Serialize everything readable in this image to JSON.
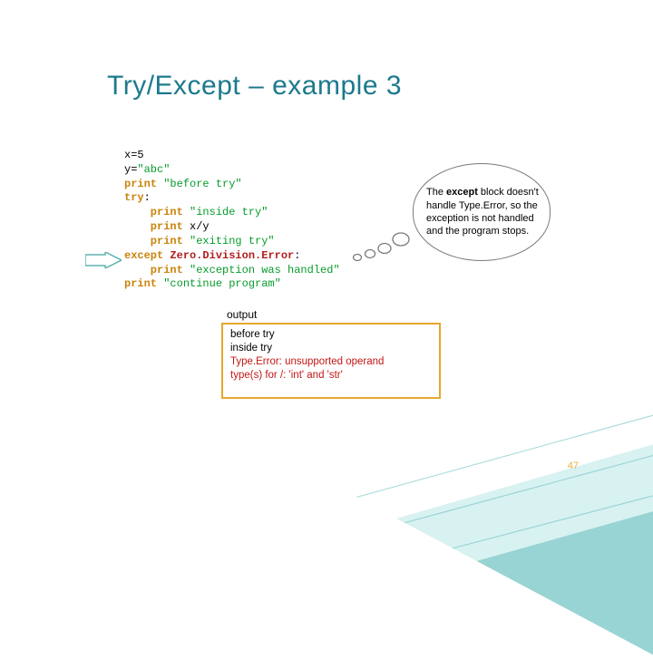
{
  "title": "Try/Except – example 3",
  "code": {
    "l1a": "x=5",
    "l2a": "y=",
    "l2b": "\"abc\"",
    "l3a": "print ",
    "l3b": "\"before try\"",
    "l4a": "try",
    "l4b": ":",
    "l5a": "    print ",
    "l5b": "\"inside try\"",
    "l6a": "    print ",
    "l6b": "x/y",
    "l7a": "    print ",
    "l7b": "\"exiting try\"",
    "l8a": "except ",
    "l8b": "Zero.Division.Error",
    "l8c": ":",
    "l9a": "    print ",
    "l9b": "\"exception was handled\"",
    "l10a": "print ",
    "l10b": "\"continue program\""
  },
  "bubble": {
    "pre": "The ",
    "bold": "except",
    "rest": " block doesn't handle Type.Error, so the exception is not handled and the program stops."
  },
  "output": {
    "label": "output",
    "line1": "before try",
    "line2": "inside try",
    "err1": "Type.Error: unsupported operand",
    "err2": "type(s) for /: 'int' and 'str'"
  },
  "page_number": "47"
}
